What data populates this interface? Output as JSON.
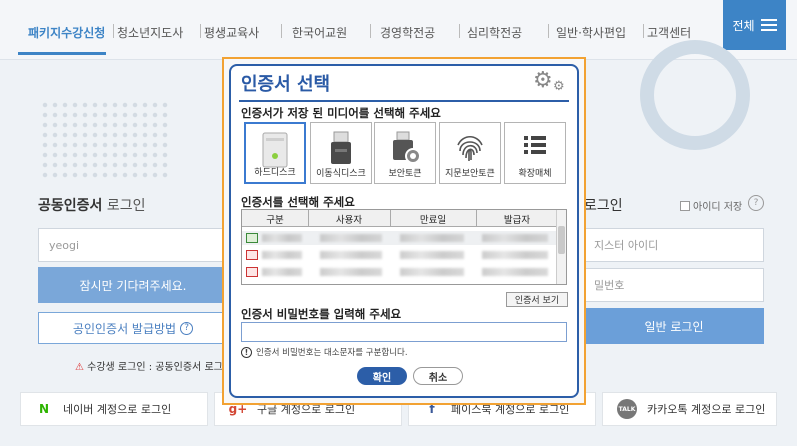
{
  "nav": {
    "items": [
      "패키지수강신청",
      "청소년지도사",
      "평생교육사",
      "한국어교원",
      "경영학전공",
      "심리학전공",
      "일반·학사편입",
      "고객센터"
    ],
    "all_label": "전체"
  },
  "left_panel": {
    "title_bold": "공동인증서",
    "title_rest": "로그인",
    "id_value": "yeogi",
    "wait_label": "잠시만 기다려주세요.",
    "issue_label": "공인인증서 발급방법",
    "warning_text": "수강생 로그인 : 공동인증서 로그인"
  },
  "right_panel": {
    "title_rest": "로그인",
    "save_id_label": "아이디 저장",
    "id_placeholder": "지스터 아이디",
    "pw_placeholder": "밀번호",
    "login_label": "일반 로그인"
  },
  "social": {
    "naver_label": "네이버 계정으로 로그인",
    "google_label": "구글 계정으로 로그인",
    "facebook_label": "페이스북 계정으로 로그인",
    "kakao_label": "카카오톡 계정으로 로그인"
  },
  "dialog": {
    "title": "인증서 선택",
    "media_prompt": "인증서가 저장 된 미디어를 선택해 주세요",
    "media": [
      {
        "label": "하드디스크",
        "icon": "hard-disk-icon"
      },
      {
        "label": "이동식디스크",
        "icon": "usb-drive-icon"
      },
      {
        "label": "보안토큰",
        "icon": "security-token-icon"
      },
      {
        "label": "지문보안토큰",
        "icon": "fingerprint-icon"
      },
      {
        "label": "확장매체",
        "icon": "list-icon"
      }
    ],
    "cert_prompt": "인증서를 선택해 주세요",
    "columns": [
      "구분",
      "사용자",
      "만료일",
      "발급자"
    ],
    "view_cert_label": "인증서 보기",
    "pwd_prompt": "인증서 비밀번호를 입력해 주세요",
    "note": "인증서 비밀번호는 대소문자를 구분합니다.",
    "ok_label": "확인",
    "cancel_label": "취소"
  }
}
